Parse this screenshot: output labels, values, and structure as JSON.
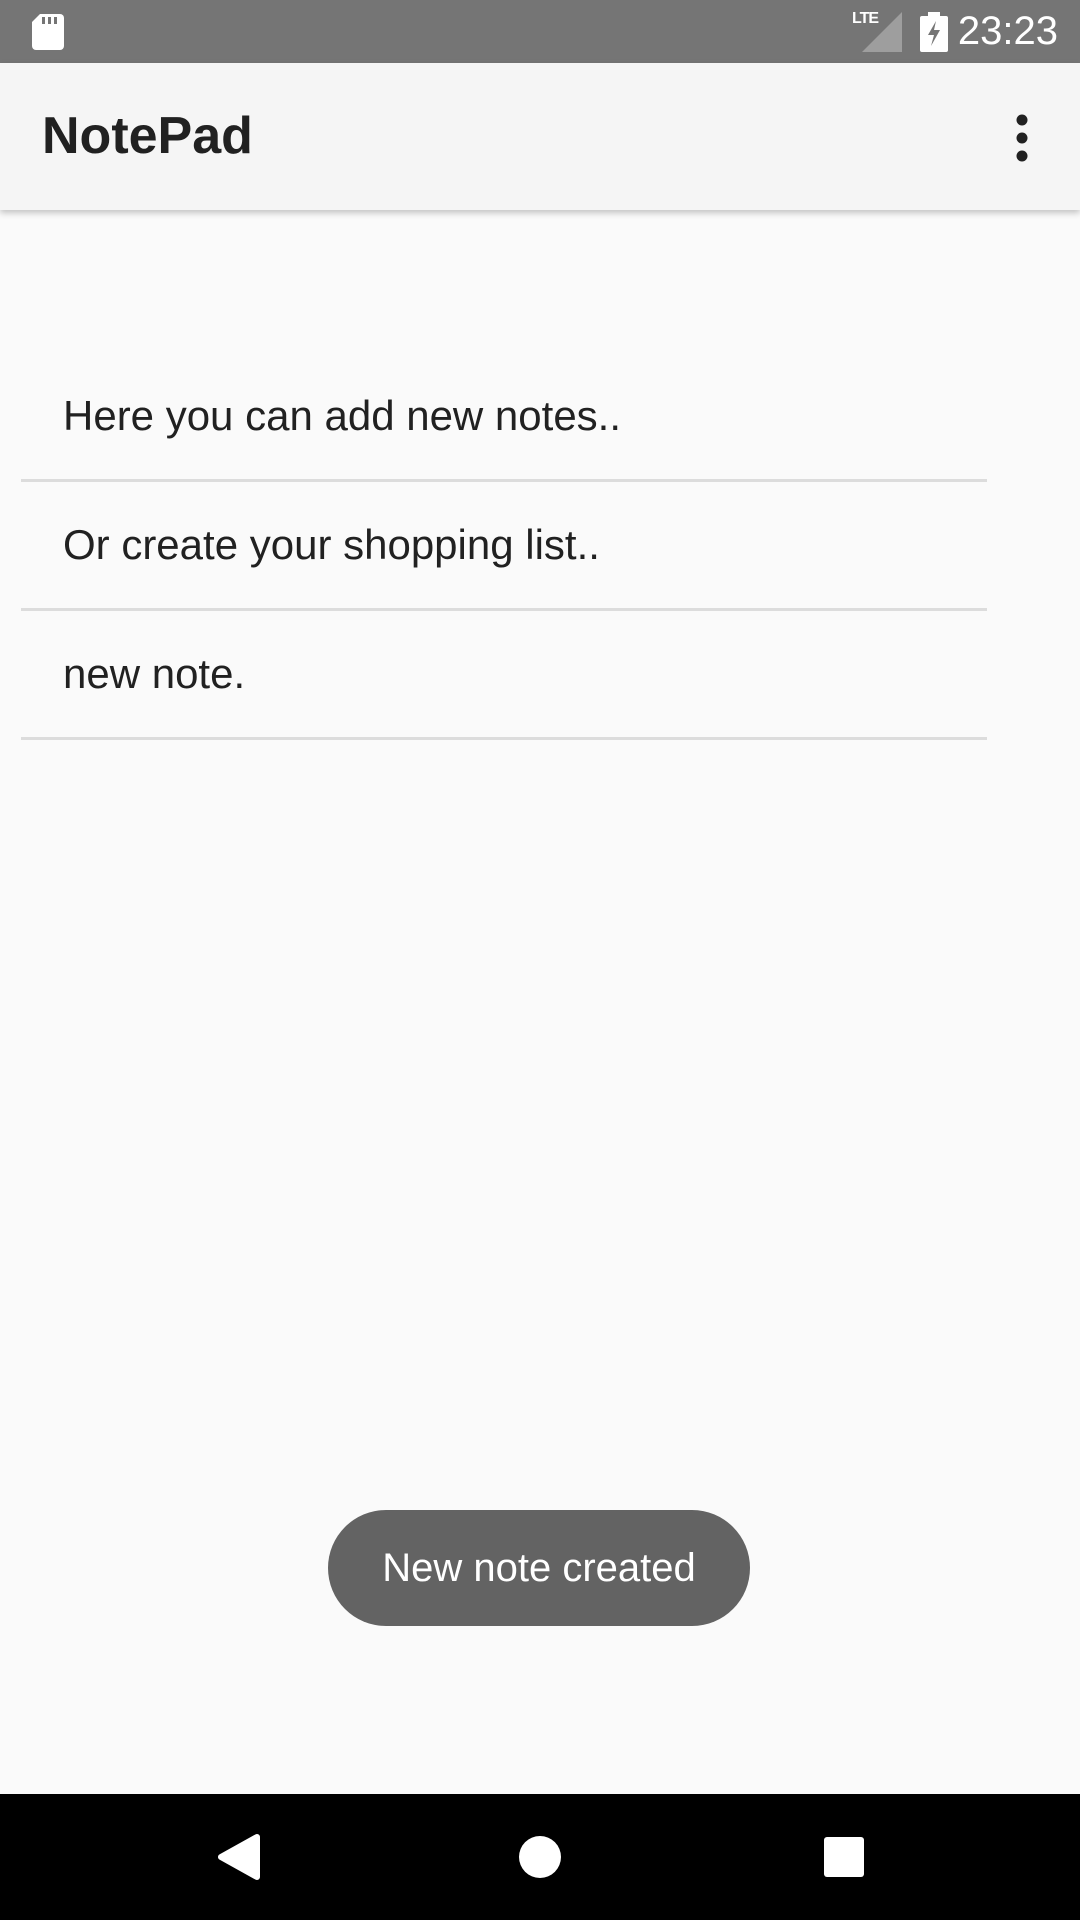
{
  "status_bar": {
    "time": "23:23",
    "network_label": "LTE",
    "icons": [
      "sd-card-icon",
      "lte-signal-icon",
      "battery-charging-icon"
    ]
  },
  "app_bar": {
    "title": "NotePad",
    "overflow_icon": "more-vert-icon"
  },
  "notes": [
    {
      "text": "Here you can add new notes.."
    },
    {
      "text": "Or create your shopping list.."
    },
    {
      "text": "new note."
    }
  ],
  "toast": {
    "message": "New note created"
  },
  "nav_bar": {
    "icons": [
      "back-icon",
      "home-icon",
      "recents-icon"
    ]
  },
  "colors": {
    "status_bar": "#757575",
    "app_bar": "#f5f5f5",
    "background": "#fafafa",
    "divider": "#dcdcdc",
    "toast": "#636363",
    "nav_bar": "#000000",
    "text_primary": "#212121"
  }
}
